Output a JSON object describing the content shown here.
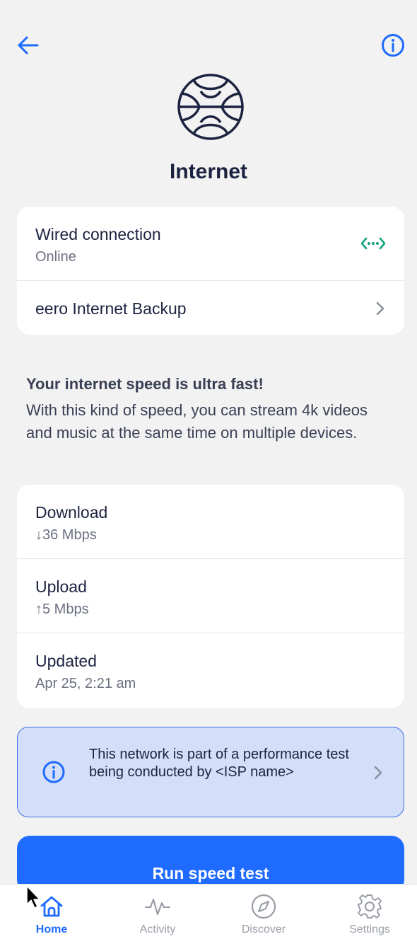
{
  "header": {
    "back_icon": "arrow-left-icon",
    "info_icon": "info-circle-icon",
    "title": "Internet",
    "hero_icon": "globe-icon"
  },
  "connection_card": {
    "wired_title": "Wired connection",
    "wired_status": "Online",
    "wired_icon": "ethernet-icon",
    "backup_label": "eero Internet Backup"
  },
  "speed_message": {
    "headline": "Your internet speed is ultra fast!",
    "body": "With this kind of speed, you can stream 4k videos and music at the same time on multiple devices."
  },
  "stats_card": {
    "download_label": "Download",
    "download_value": "↓36 Mbps",
    "upload_label": "Upload",
    "upload_value": "↑5 Mbps",
    "updated_label": "Updated",
    "updated_value": "Apr 25, 2:21 am"
  },
  "notice": {
    "text": "This network is part of a performance test being conducted by <ISP name>"
  },
  "run_button": {
    "label": "Run speed test"
  },
  "tabbar": {
    "home": "Home",
    "activity": "Activity",
    "discover": "Discover",
    "settings": "Settings"
  },
  "colors": {
    "accent": "#1f6bff",
    "background": "#f2f2f2",
    "online": "#12a37f",
    "notice_bg": "#d3dff8"
  }
}
